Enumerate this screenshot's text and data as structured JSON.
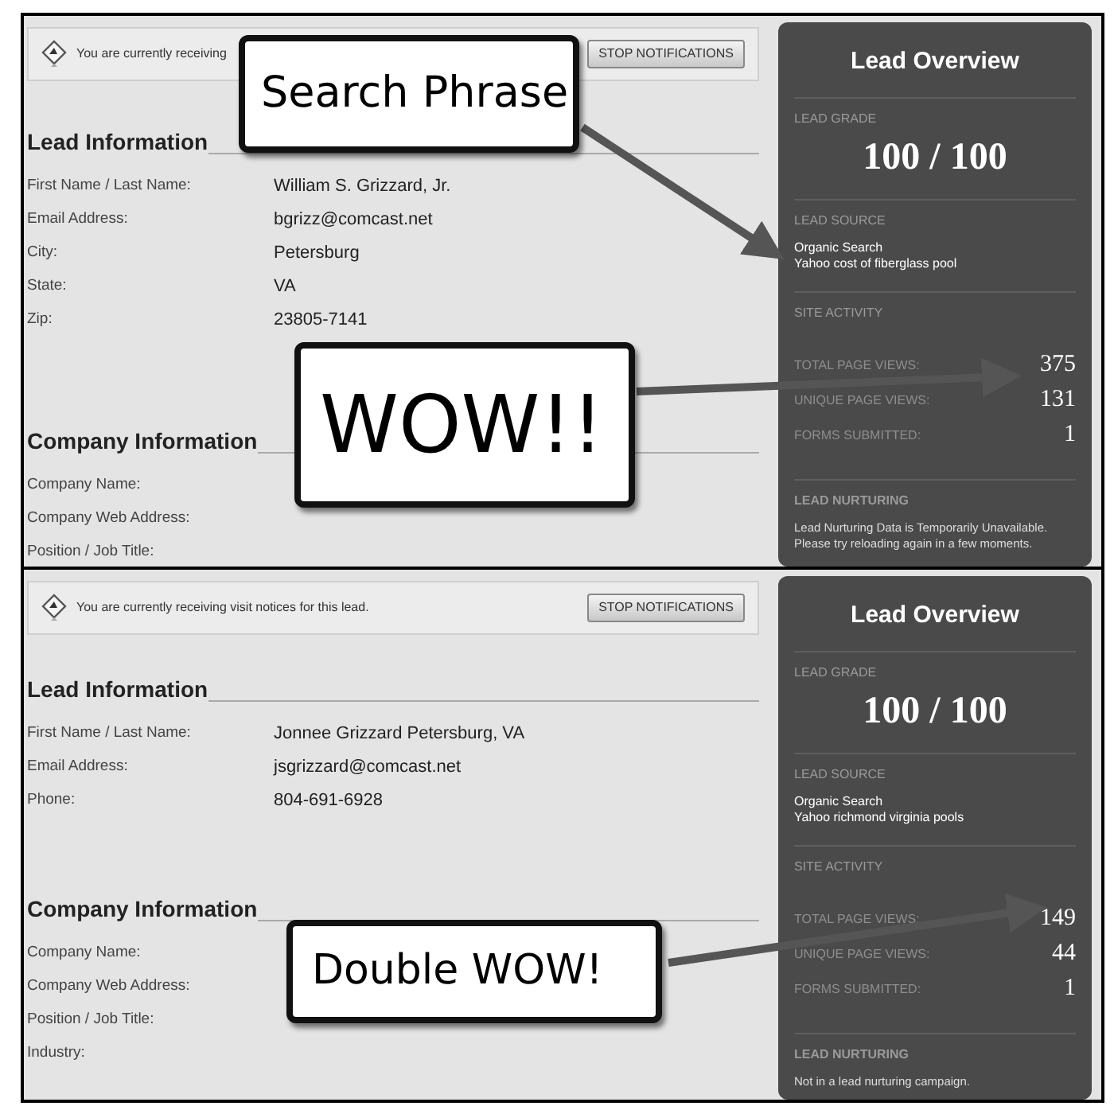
{
  "panels": [
    {
      "notice": {
        "text": "You are currently receiving",
        "button": "STOP NOTIFICATIONS"
      },
      "lead_information": {
        "title": "Lead Information",
        "fields": [
          {
            "label": "First Name / Last Name:",
            "value": "William S. Grizzard, Jr."
          },
          {
            "label": "Email Address:",
            "value": "bgrizz@comcast.net"
          },
          {
            "label": "City:",
            "value": "Petersburg"
          },
          {
            "label": "State:",
            "value": "VA"
          },
          {
            "label": "Zip:",
            "value": "23805-7141"
          }
        ]
      },
      "company_information": {
        "title": "Company Information",
        "fields": [
          {
            "label": "Company Name:"
          },
          {
            "label": "Company Web Address:"
          },
          {
            "label": "Position / Job Title:"
          }
        ]
      },
      "overview": {
        "title": "Lead Overview",
        "grade_label": "LEAD GRADE",
        "grade": "100 / 100",
        "source_label": "LEAD SOURCE",
        "source_lines": [
          "Organic Search",
          "Yahoo cost of fiberglass pool"
        ],
        "activity_label": "SITE ACTIVITY",
        "stats": [
          {
            "label": "TOTAL PAGE VIEWS:",
            "value": "375"
          },
          {
            "label": "UNIQUE PAGE VIEWS:",
            "value": "131"
          },
          {
            "label": "FORMS SUBMITTED:",
            "value": "1"
          }
        ],
        "nurturing_label": "LEAD NURTURING",
        "nurturing_lines": [
          "Lead Nurturing Data is Temporarily Unavailable.",
          "Please try reloading again in a few moments."
        ]
      }
    },
    {
      "notice": {
        "text": "You are currently receiving visit notices for this lead.",
        "button": "STOP NOTIFICATIONS"
      },
      "lead_information": {
        "title": "Lead Information",
        "fields": [
          {
            "label": "First Name / Last Name:",
            "value": "Jonnee Grizzard Petersburg, VA"
          },
          {
            "label": "Email Address:",
            "value": "jsgrizzard@comcast.net"
          },
          {
            "label": "Phone:",
            "value": "804-691-6928"
          }
        ]
      },
      "company_information": {
        "title": "Company Information",
        "fields": [
          {
            "label": "Company Name:"
          },
          {
            "label": "Company Web Address:"
          },
          {
            "label": "Position / Job Title:"
          },
          {
            "label": "Industry:"
          }
        ]
      },
      "overview": {
        "title": "Lead Overview",
        "grade_label": "LEAD GRADE",
        "grade": "100 / 100",
        "source_label": "LEAD SOURCE",
        "source_lines": [
          "Organic Search",
          "Yahoo richmond virginia pools"
        ],
        "activity_label": "SITE ACTIVITY",
        "stats": [
          {
            "label": "TOTAL PAGE VIEWS:",
            "value": "149"
          },
          {
            "label": "UNIQUE PAGE VIEWS:",
            "value": "44"
          },
          {
            "label": "FORMS SUBMITTED:",
            "value": "1"
          }
        ],
        "nurturing_label": "LEAD NURTURING",
        "nurturing_lines": [
          "Not in a lead nurturing campaign."
        ]
      }
    }
  ],
  "callouts": [
    "Search Phrase",
    "WOW!!",
    "Double WOW!"
  ]
}
